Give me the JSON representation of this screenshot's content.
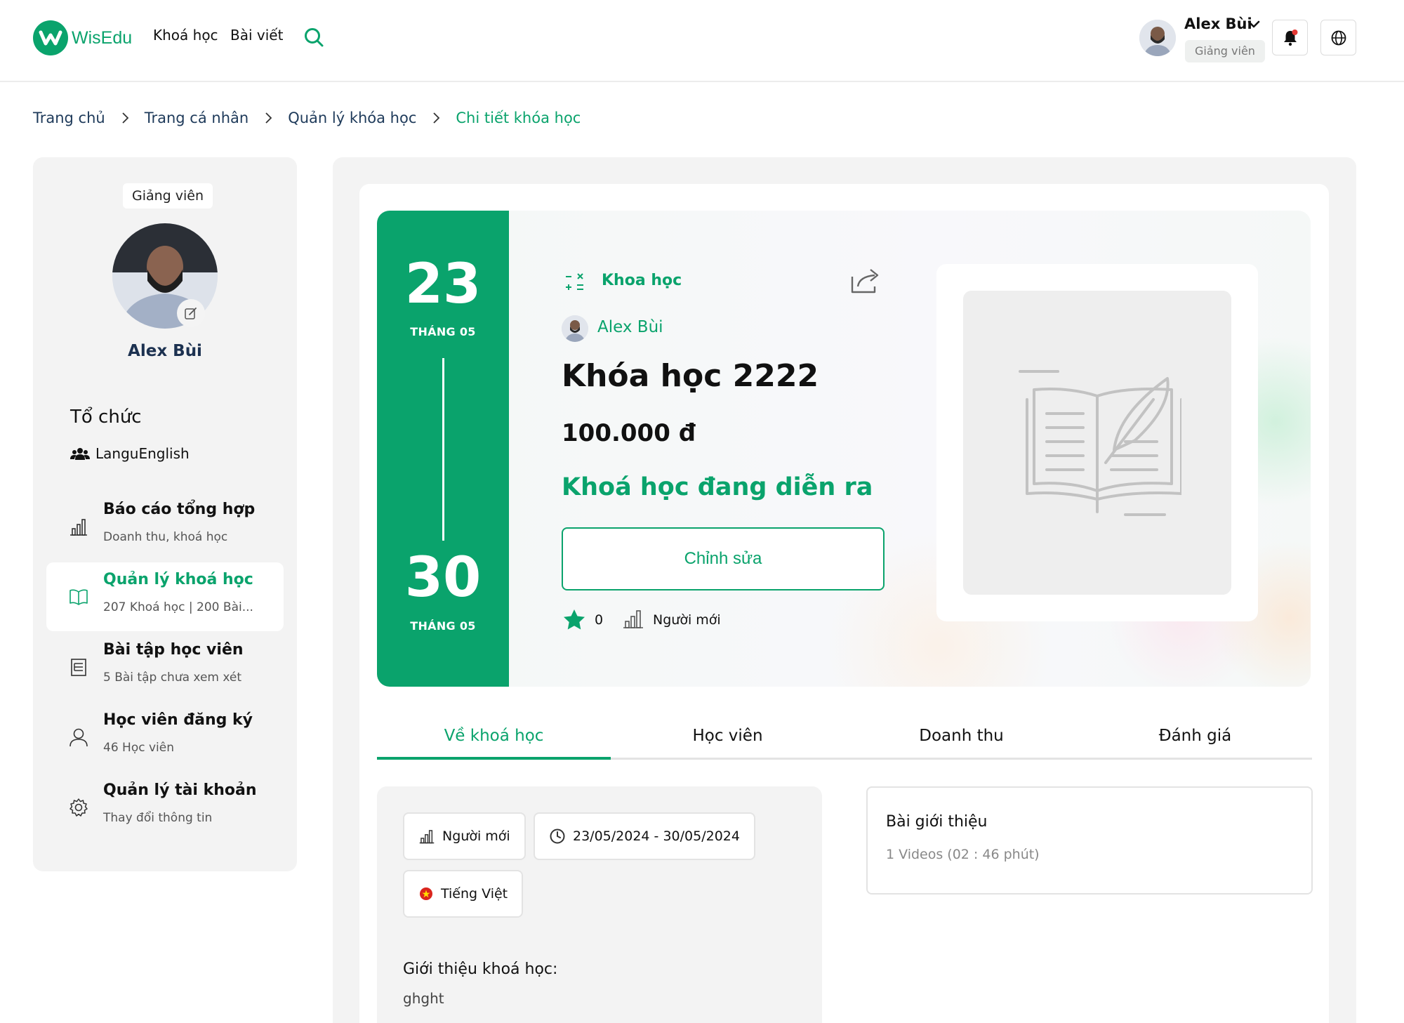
{
  "header": {
    "logo_text": "WisEdu",
    "nav": [
      "Khoá học",
      "Bài viết"
    ],
    "user_name": "Alex Bùi",
    "user_role": "Giảng viên"
  },
  "breadcrumb": [
    "Trang chủ",
    "Trang cá nhân",
    "Quản lý khóa học",
    "Chi tiết khóa học"
  ],
  "sidebar": {
    "role": "Giảng viên",
    "name": "Alex Bùi",
    "org_title": "Tổ chức",
    "org_name": "LanguEnglish",
    "menu": [
      {
        "title": "Báo cáo tổng hợp",
        "sub": "Doanh thu, khoá học",
        "icon": "bar-chart-icon"
      },
      {
        "title": "Quản lý khoá học",
        "sub": "207 Khoá học | 200 Bài...",
        "icon": "book-open-icon",
        "active": true
      },
      {
        "title": "Bài tập học viên",
        "sub": "5 Bài tập chưa xem xét",
        "icon": "document-list-icon"
      },
      {
        "title": "Học viên đăng ký",
        "sub": "46 Học viên",
        "icon": "user-icon"
      },
      {
        "title": "Quản lý tài khoản",
        "sub": "Thay đổi thông tin",
        "icon": "gear-icon"
      }
    ]
  },
  "course": {
    "start_day": "23",
    "start_month": "THÁNG 05",
    "end_day": "30",
    "end_month": "THÁNG 05",
    "category": "Khoa học",
    "author": "Alex Bùi",
    "title": "Khóa học 2222",
    "price": "100.000 đ",
    "status": "Khoá học đang diễn ra",
    "edit_label": "Chỉnh sửa",
    "rating": "0",
    "level": "Người mới"
  },
  "tabs": [
    "Về khoá học",
    "Học viên",
    "Doanh thu",
    "Đánh giá"
  ],
  "about": {
    "level": "Người mới",
    "date_range": "23/05/2024 - 30/05/2024",
    "language": "Tiếng Việt",
    "heading": "Giới thiệu khoá học:",
    "text": "ghght"
  },
  "intro": {
    "title": "Bài giới thiệu",
    "sub": "1 Videos (02 : 46 phút)"
  },
  "colors": {
    "accent": "#0aa36c",
    "breadcrumb_text": "#1e3a5a",
    "panel_bg": "#f3f3f3"
  }
}
